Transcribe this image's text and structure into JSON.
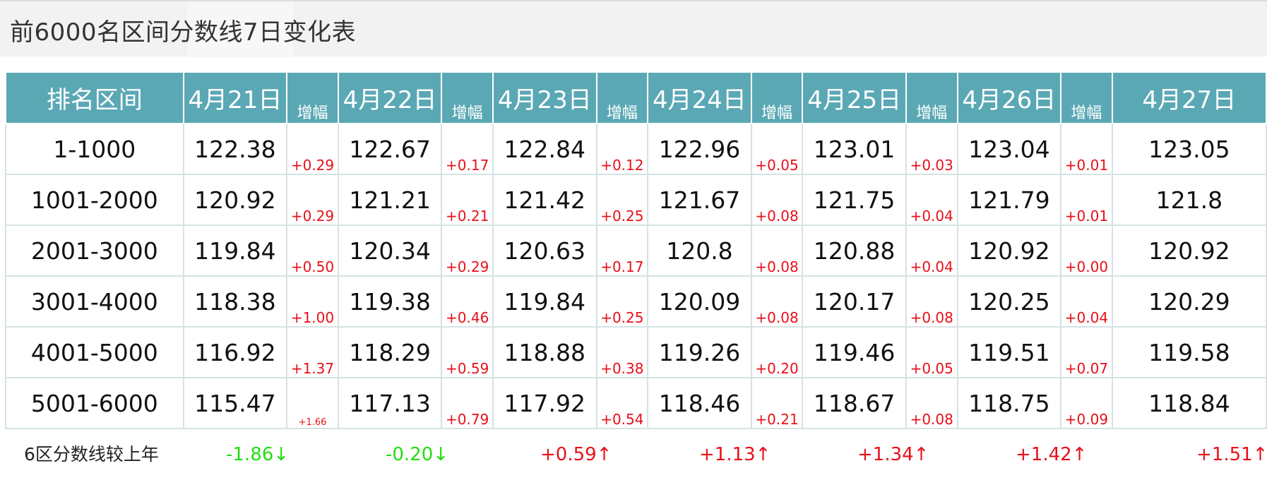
{
  "title": "前6000名区间分数线7日变化表",
  "header": {
    "range_label": "排名区间",
    "inc_label": "增幅",
    "dates": [
      "4月21日",
      "4月22日",
      "4月23日",
      "4月24日",
      "4月25日",
      "4月26日",
      "4月27日"
    ]
  },
  "rows": [
    {
      "range": "1-1000",
      "values": [
        "122.38",
        "122.67",
        "122.84",
        "122.96",
        "123.01",
        "123.04",
        "123.05"
      ],
      "increments": [
        "+0.29",
        "+0.17",
        "+0.12",
        "+0.05",
        "+0.03",
        "+0.01"
      ]
    },
    {
      "range": "1001-2000",
      "values": [
        "120.92",
        "121.21",
        "121.42",
        "121.67",
        "121.75",
        "121.79",
        "121.8"
      ],
      "increments": [
        "+0.29",
        "+0.21",
        "+0.25",
        "+0.08",
        "+0.04",
        "+0.01"
      ]
    },
    {
      "range": "2001-3000",
      "values": [
        "119.84",
        "120.34",
        "120.63",
        "120.8",
        "120.88",
        "120.92",
        "120.92"
      ],
      "increments": [
        "+0.50",
        "+0.29",
        "+0.17",
        "+0.08",
        "+0.04",
        "+0.00"
      ]
    },
    {
      "range": "3001-4000",
      "values": [
        "118.38",
        "119.38",
        "119.84",
        "120.09",
        "120.17",
        "120.25",
        "120.29"
      ],
      "increments": [
        "+1.00",
        "+0.46",
        "+0.25",
        "+0.08",
        "+0.08",
        "+0.04"
      ]
    },
    {
      "range": "4001-5000",
      "values": [
        "116.92",
        "118.29",
        "118.88",
        "119.26",
        "119.46",
        "119.51",
        "119.58"
      ],
      "increments": [
        "+1.37",
        "+0.59",
        "+0.38",
        "+0.20",
        "+0.05",
        "+0.07"
      ]
    },
    {
      "range": "5001-6000",
      "values": [
        "115.47",
        "117.13",
        "117.92",
        "118.46",
        "118.67",
        "118.75",
        "118.84"
      ],
      "increments": [
        "+1.66",
        "+0.79",
        "+0.54",
        "+0.21",
        "+0.08",
        "+0.09"
      ]
    }
  ],
  "footer": {
    "label": "6区分数线较上年",
    "values": [
      "-1.86↓",
      "-0.20↓",
      "+0.59↑",
      "+1.13↑",
      "+1.34↑",
      "+1.42↑",
      "+1.51↑"
    ]
  },
  "colors": {
    "header_bg": "#5ba8b5",
    "increase": "#e8101a",
    "decrease": "#22dd11"
  }
}
